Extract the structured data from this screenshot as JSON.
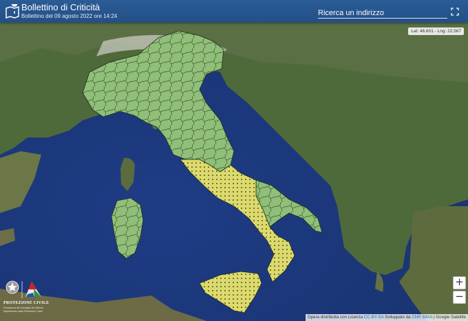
{
  "header": {
    "title": "Bollettino di Criticità",
    "subtitle": "Bollettino del 09 agosto 2022 ore 14:24",
    "logo_icon": "map-pin-icon"
  },
  "search": {
    "placeholder": "Ricerca un indirizzo"
  },
  "controls": {
    "fullscreen_icon": "expand-icon",
    "zoom_in": "+",
    "zoom_out": "−"
  },
  "coordinates": "Lat: 46.601 - Lng: 22.567",
  "branding": {
    "name": "PROTEZIONE CIVILE",
    "line1": "Presidenza del Consiglio dei Ministri",
    "line2": "Dipartimento della Protezione Civile"
  },
  "attribution": {
    "text1": "Opera distribuita con Licenza ",
    "license": "CC-BY-SA",
    "text2": " Sviluppato da ",
    "developer": "CNR IMAA",
    "text3": " | Google Satellite"
  },
  "legend_colors": {
    "green": "#8fbf78",
    "yellow": "#dcda6c",
    "sea": "#203f80",
    "land": "#4e6b38"
  }
}
